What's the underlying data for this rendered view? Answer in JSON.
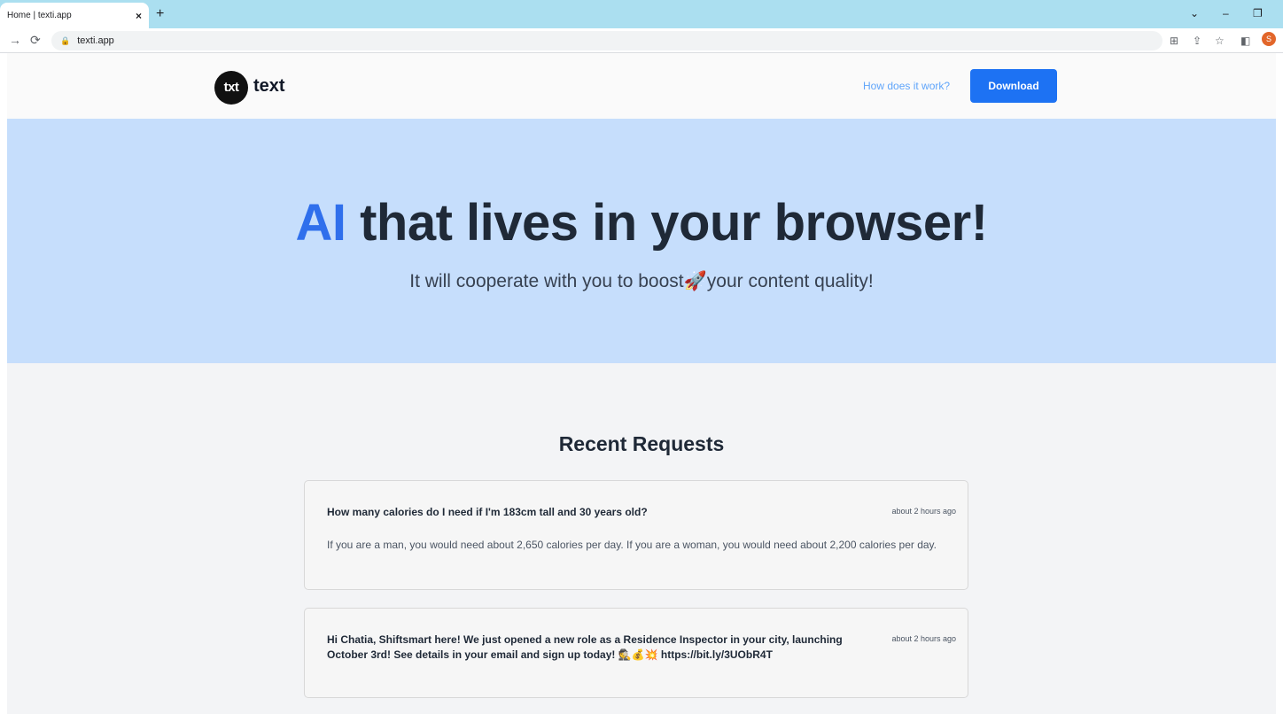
{
  "browser": {
    "tab_title": "Home | texti.app",
    "tab_close": "×",
    "new_tab": "+",
    "url": "texti.app",
    "profile_initial": "S"
  },
  "header": {
    "logo_mark": "txt",
    "logo_text": "text",
    "nav_link": "How does it work?",
    "download_label": "Download"
  },
  "hero": {
    "title_accent": "AI",
    "title_rest": " that lives in your browser!",
    "subtitle_before": "It will cooperate with you to boost",
    "subtitle_after": "your content quality!"
  },
  "recent": {
    "title": "Recent Requests",
    "items": [
      {
        "question": "How many calories do I need if I'm 183cm tall and 30 years old?",
        "time": "about 2 hours ago",
        "answer": "If you are a man, you would need about 2,650 calories per day. If you are a woman, you would need about 2,200 calories per day."
      },
      {
        "question": "Hi Chatia, Shiftsmart here! We just opened a new role as a Residence Inspector in your city, launching October 3rd! See details in your email and sign up today! 🕵️💰💥 https://bit.ly/3UObR4T",
        "time": "about 2 hours ago",
        "answer": ""
      }
    ]
  },
  "colors": {
    "accent": "#2f6fec",
    "button": "#1d72f3",
    "hero_bg": "#c6defc",
    "tab_strip": "#abdff0"
  }
}
